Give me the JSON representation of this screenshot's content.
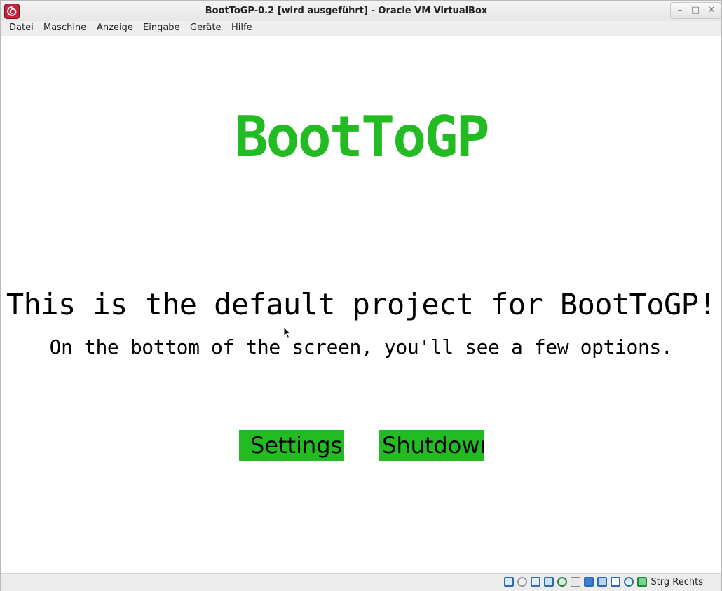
{
  "window": {
    "title": "BootToGP-0.2 [wird ausgeführt] - Oracle VM VirtualBox",
    "controls": [
      "minimize",
      "maximize",
      "close"
    ]
  },
  "menubar": {
    "items": [
      {
        "label": "Datei"
      },
      {
        "label": "Maschine"
      },
      {
        "label": "Anzeige"
      },
      {
        "label": "Eingabe"
      },
      {
        "label": "Geräte"
      },
      {
        "label": "Hilfe"
      }
    ]
  },
  "guest": {
    "logo": "BootToGP",
    "headline": "This is the default project for BootToGP!",
    "subline": "On the bottom of the screen, you'll see a few options.",
    "buttons": [
      {
        "label": "Settings"
      },
      {
        "label": "Shutdown"
      }
    ],
    "accent_color": "#22bb22"
  },
  "statusbar": {
    "icons": [
      "hard-disk-icon",
      "optical-drive-icon",
      "audio-icon",
      "network-icon",
      "usb-icon",
      "shared-folders-icon",
      "display-icon",
      "video-capture-icon",
      "virtualization-icon",
      "mouse-integration-icon",
      "keyboard-capture-icon"
    ],
    "host_key": "Strg Rechts"
  }
}
